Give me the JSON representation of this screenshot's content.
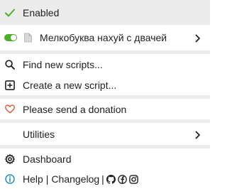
{
  "colors": {
    "accent_green": "#4caf2a",
    "heart_red": "#e05a44",
    "help_blue": "#1e8fc6",
    "highlight_bg": "#ececec"
  },
  "menu": {
    "enabled_label": "Enabled",
    "script": {
      "name": "Мелкобуква нахуй с двачей",
      "enabled": true
    },
    "find_scripts_label": "Find new scripts...",
    "create_script_label": "Create a new script...",
    "donate_label": "Please send a donation",
    "utilities_label": "Utilities",
    "dashboard_label": "Dashboard",
    "help_label": "Help",
    "separator_1": "|",
    "changelog_label": "Changelog",
    "separator_2": "|"
  },
  "icons": {
    "enabled": "checkmark-icon",
    "script_toggle": "toggle-switch",
    "script_file": "document-icon",
    "script_submenu": "chevron-right-icon",
    "find": "search-icon",
    "create": "plus-square-icon",
    "donate": "heart-icon",
    "utilities_submenu": "chevron-right-icon",
    "dashboard": "gear-icon",
    "help": "info-icon",
    "social": [
      "github-icon",
      "facebook-icon",
      "instagram-icon"
    ]
  }
}
